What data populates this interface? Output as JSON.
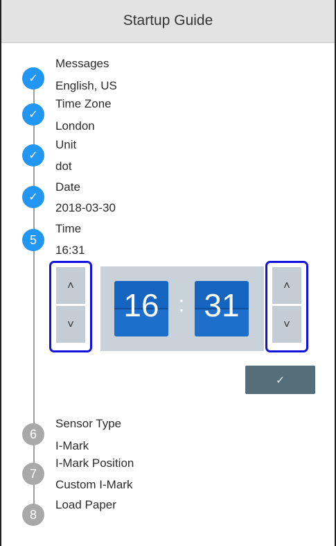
{
  "header": {
    "title": "Startup Guide"
  },
  "steps": [
    {
      "marker": "✓",
      "title": "Messages",
      "value": "English, US"
    },
    {
      "marker": "✓",
      "title": "Time Zone",
      "value": "London"
    },
    {
      "marker": "✓",
      "title": "Unit",
      "value": "dot"
    },
    {
      "marker": "✓",
      "title": "Date",
      "value": "2018-03-30"
    },
    {
      "marker": "5",
      "title": "Time",
      "value": "16:31"
    },
    {
      "marker": "6",
      "title": "Sensor Type",
      "value": "I-Mark"
    },
    {
      "marker": "7",
      "title": "I-Mark Position",
      "value": "Custom I-Mark"
    },
    {
      "marker": "8",
      "title": "Load Paper",
      "value": ""
    }
  ],
  "picker": {
    "hour": "16",
    "minute": "31",
    "separator": ":",
    "up_glyph": "˄",
    "down_glyph": "˅"
  },
  "confirm": {
    "glyph": "✓"
  },
  "colors": {
    "step_done": "#2196f3",
    "step_pending": "#a9a9a9",
    "digit_box": "#1565c0",
    "highlight_border": "#1111dd",
    "confirm_button": "#546e7a"
  },
  "icons": {
    "done": "check-icon",
    "up": "chevron-up-icon",
    "down": "chevron-down-icon",
    "confirm": "check-icon"
  }
}
